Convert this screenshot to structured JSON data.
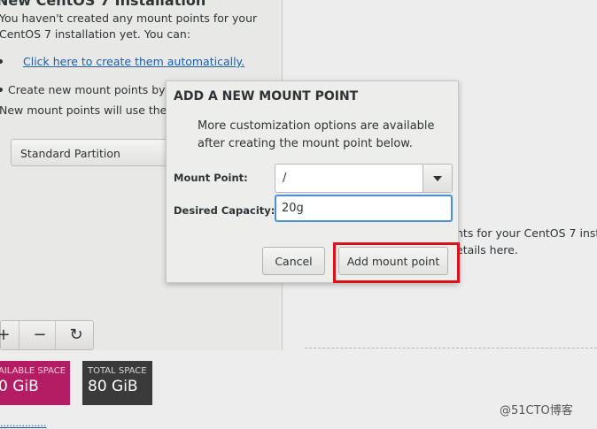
{
  "left": {
    "title": "New CentOS 7 Installation",
    "intro": "You haven't created any mount points for your CentOS 7 installation yet.  You can:",
    "auto_link": "Click here to create them automatically.",
    "create_text": "Create new mount points by cl",
    "scheme_text": "New mount points will use the fo scheme:",
    "scheme_value": "Standard Partition",
    "toolbar": {
      "add": "+",
      "remove": "−",
      "refresh": "↻"
    },
    "available_space": {
      "label": "AILABLE SPACE",
      "value": "0 GiB"
    },
    "total_space": {
      "label": "TOTAL SPACE",
      "value": "80 GiB"
    },
    "bottom_link": "..............."
  },
  "right": {
    "line1": "nts for your CentOS 7 inst",
    "line2": "etails here."
  },
  "dialog": {
    "title": "ADD A NEW MOUNT POINT",
    "description": "More customization options are available after creating the mount point below.",
    "mount_point_label": "Mount Point:",
    "mount_point_value": "/",
    "capacity_label": "Desired Capacity:",
    "capacity_value": "20g",
    "cancel_label": "Cancel",
    "add_label": "Add mount point"
  },
  "watermark": "@51CTO博客",
  "colors": {
    "available_bg": "#b41d63",
    "total_bg": "#3a3a3a",
    "highlight": "#e0101a",
    "focus": "#4a90d9",
    "link": "#1a5fb4"
  }
}
